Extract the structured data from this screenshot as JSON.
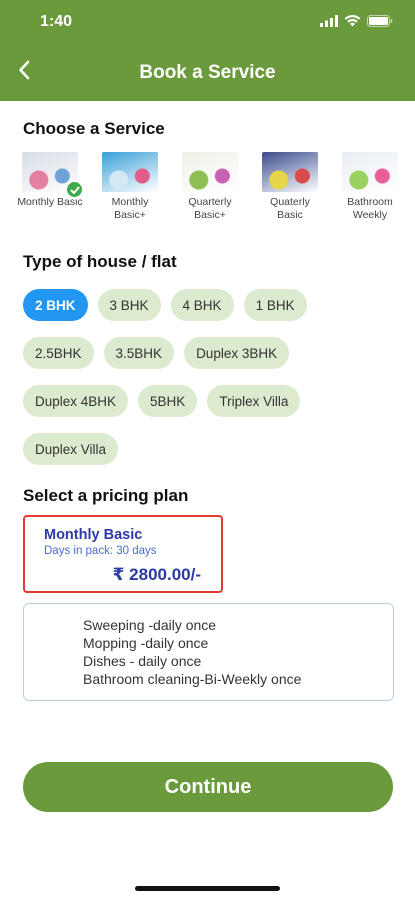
{
  "status_bar": {
    "time": "1:40"
  },
  "header": {
    "title": "Book a Service"
  },
  "services_section": {
    "title": "Choose a Service",
    "items": [
      {
        "label": "Monthly Basic",
        "selected": true,
        "colors": [
          "#d7dce6",
          "#e27fa2",
          "#6fa3d8"
        ]
      },
      {
        "label": "Monthly Basic+",
        "selected": false,
        "colors": [
          "#3aa0d8",
          "#d2e9f5",
          "#e35b8a"
        ]
      },
      {
        "label": "Quarterly Basic+",
        "selected": false,
        "colors": [
          "#eef1e6",
          "#8fbe55",
          "#c861b3"
        ]
      },
      {
        "label": "Quaterly Basic",
        "selected": false,
        "colors": [
          "#3a4d8f",
          "#e6d64a",
          "#d94b4b"
        ]
      },
      {
        "label": "Bathroom Weekly",
        "selected": false,
        "colors": [
          "#e9eef3",
          "#9bd15e",
          "#e85f97"
        ]
      }
    ]
  },
  "house_section": {
    "title": "Type of house / flat",
    "rows": [
      [
        {
          "label": "2 BHK",
          "selected": true
        },
        {
          "label": "3 BHK"
        },
        {
          "label": "4 BHK"
        },
        {
          "label": "1 BHK"
        }
      ],
      [
        {
          "label": "2.5BHK"
        },
        {
          "label": "3.5BHK"
        },
        {
          "label": "Duplex 3BHK"
        }
      ],
      [
        {
          "label": "Duplex 4BHK"
        },
        {
          "label": "5BHK"
        },
        {
          "label": "Triplex Villa"
        }
      ],
      [
        {
          "label": "Duplex Villa"
        }
      ]
    ]
  },
  "pricing_section": {
    "title": "Select a pricing plan",
    "plan": {
      "name": "Monthly Basic",
      "days": "Days in pack: 30 days",
      "price": "₹ 2800.00/-"
    }
  },
  "features": [
    "Sweeping -daily once",
    "Mopping -daily once",
    "Dishes - daily once",
    "Bathroom cleaning-Bi-Weekly once"
  ],
  "continue_button": {
    "label": "Continue"
  },
  "colors": {
    "brand": "#6b9a3c",
    "chip_bg": "#dcebd0",
    "chip_selected": "#2196f3",
    "plan_border": "#e53935",
    "plan_text": "#2b3aa6"
  }
}
